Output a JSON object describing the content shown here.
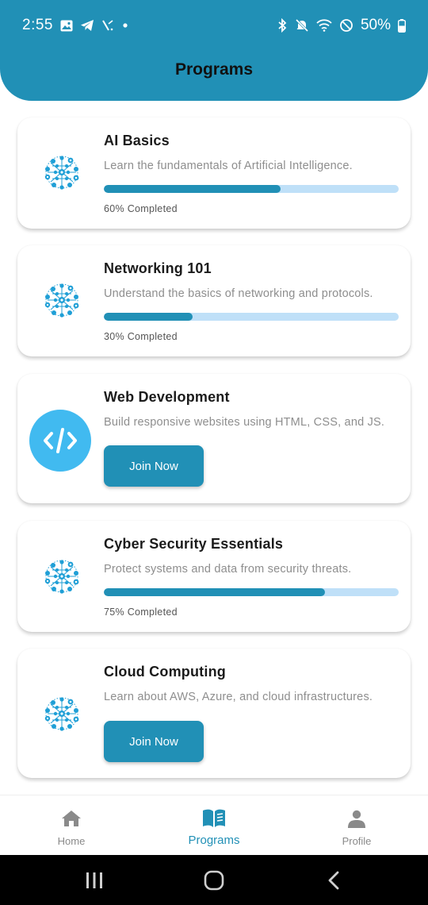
{
  "status_bar": {
    "time": "2:55",
    "battery": "50%",
    "left_icons": [
      "gallery-icon",
      "telegram-icon",
      "signal-slash-icon",
      "dot-icon"
    ],
    "right_icons": [
      "bluetooth-icon",
      "mute-icon",
      "wifi-icon",
      "dnd-icon",
      "battery-icon"
    ]
  },
  "header": {
    "title": "Programs",
    "color": "#2190b6"
  },
  "programs": [
    {
      "title": "AI Basics",
      "description": "Learn the fundamentals of Artificial Intelligence.",
      "progress": 60,
      "progress_label": "60% Completed",
      "icon": "network-globe-icon"
    },
    {
      "title": "Networking 101",
      "description": "Understand the basics of networking and protocols.",
      "progress": 30,
      "progress_label": "30% Completed",
      "icon": "network-globe-icon"
    },
    {
      "title": "Web Development",
      "description": "Build responsive websites using HTML, CSS, and JS.",
      "button_label": "Join Now",
      "icon": "code-icon"
    },
    {
      "title": "Cyber Security Essentials",
      "description": "Protect systems and data from security threats.",
      "progress": 75,
      "progress_label": "75% Completed",
      "icon": "network-globe-icon"
    },
    {
      "title": "Cloud Computing",
      "description": "Learn about AWS, Azure, and cloud infrastructures.",
      "button_label": "Join Now",
      "icon": "network-globe-icon"
    }
  ],
  "bottom_nav": {
    "items": [
      {
        "label": "Home",
        "icon": "home-icon",
        "active": false
      },
      {
        "label": "Programs",
        "icon": "book-icon",
        "active": true
      },
      {
        "label": "Profile",
        "icon": "person-icon",
        "active": false
      }
    ]
  },
  "system_nav": [
    "recents-icon",
    "home-circle-icon",
    "back-icon"
  ],
  "colors": {
    "accent": "#2190b6",
    "track": "#bfe0f8",
    "code_circle": "#41baf0"
  }
}
